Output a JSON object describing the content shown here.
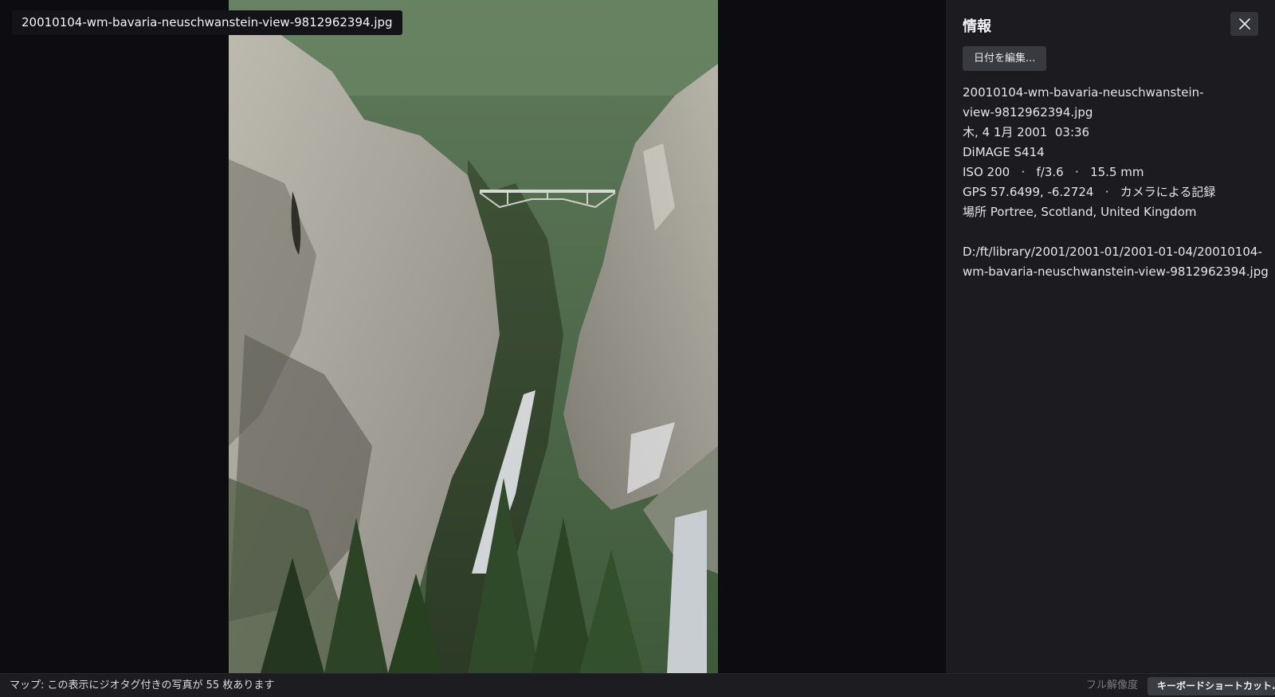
{
  "viewer": {
    "filename": "20010104-wm-bavaria-neuschwanstein-view-9812962394.jpg"
  },
  "panel": {
    "title": "情報",
    "close_icon": "close-icon",
    "edit_date_label": "日付を編集...",
    "filename_line1": "20010104-wm-bavaria-neuschwanstein-",
    "filename_line2": "view-9812962394.jpg",
    "date": "木, 4 1月 2001  03:36",
    "camera": "DiMAGE S414",
    "exposure": "ISO 200   ·   f/3.6   ·   15.5 mm",
    "gps": "GPS 57.6499, -6.2724   ·   カメラによる記録",
    "location": "場所 Portree, Scotland, United Kingdom",
    "path_line1": "D:/ft/library/2001/2001-01/2001-01-04/20010104-",
    "path_line2": "wm-bavaria-neuschwanstein-view-9812962394.jpg"
  },
  "statusbar": {
    "map_text": "マップ: この表示にジオタグ付きの写真が 55 枚あります",
    "full_resolution": "フル解像度",
    "shortcuts_label": "キーボードショートカット..."
  }
}
